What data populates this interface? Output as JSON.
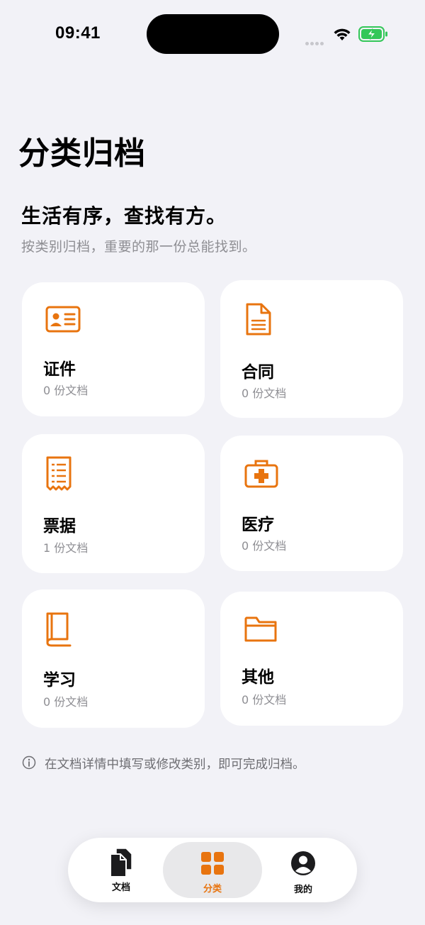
{
  "status_bar": {
    "time": "09:41"
  },
  "header": {
    "title": "分类归档",
    "hero_title": "生活有序，查找有方。",
    "hero_subtitle": "按类别归档，重要的那一份总能找到。"
  },
  "categories": [
    {
      "name": "证件",
      "count": "0 份文档",
      "icon": "id-card-icon"
    },
    {
      "name": "合同",
      "count": "0 份文档",
      "icon": "document-icon"
    },
    {
      "name": "票据",
      "count": "1 份文档",
      "icon": "receipt-icon"
    },
    {
      "name": "医疗",
      "count": "0 份文档",
      "icon": "medical-kit-icon"
    },
    {
      "name": "学习",
      "count": "0 份文档",
      "icon": "book-icon"
    },
    {
      "name": "其他",
      "count": "0 份文档",
      "icon": "folder-icon"
    }
  ],
  "hint": {
    "text": "在文档详情中填写或修改类别，即可完成归档。",
    "icon": "info-icon"
  },
  "tabbar": {
    "tabs": [
      {
        "label": "文档",
        "icon": "documents-icon"
      },
      {
        "label": "分类",
        "icon": "grid-icon",
        "active": true
      },
      {
        "label": "我的",
        "icon": "profile-icon"
      }
    ]
  },
  "colors": {
    "accent": "#e8740f",
    "background": "#f2f2f7",
    "card": "#ffffff",
    "secondary_text": "#8e8e93",
    "battery_green": "#34c759"
  }
}
